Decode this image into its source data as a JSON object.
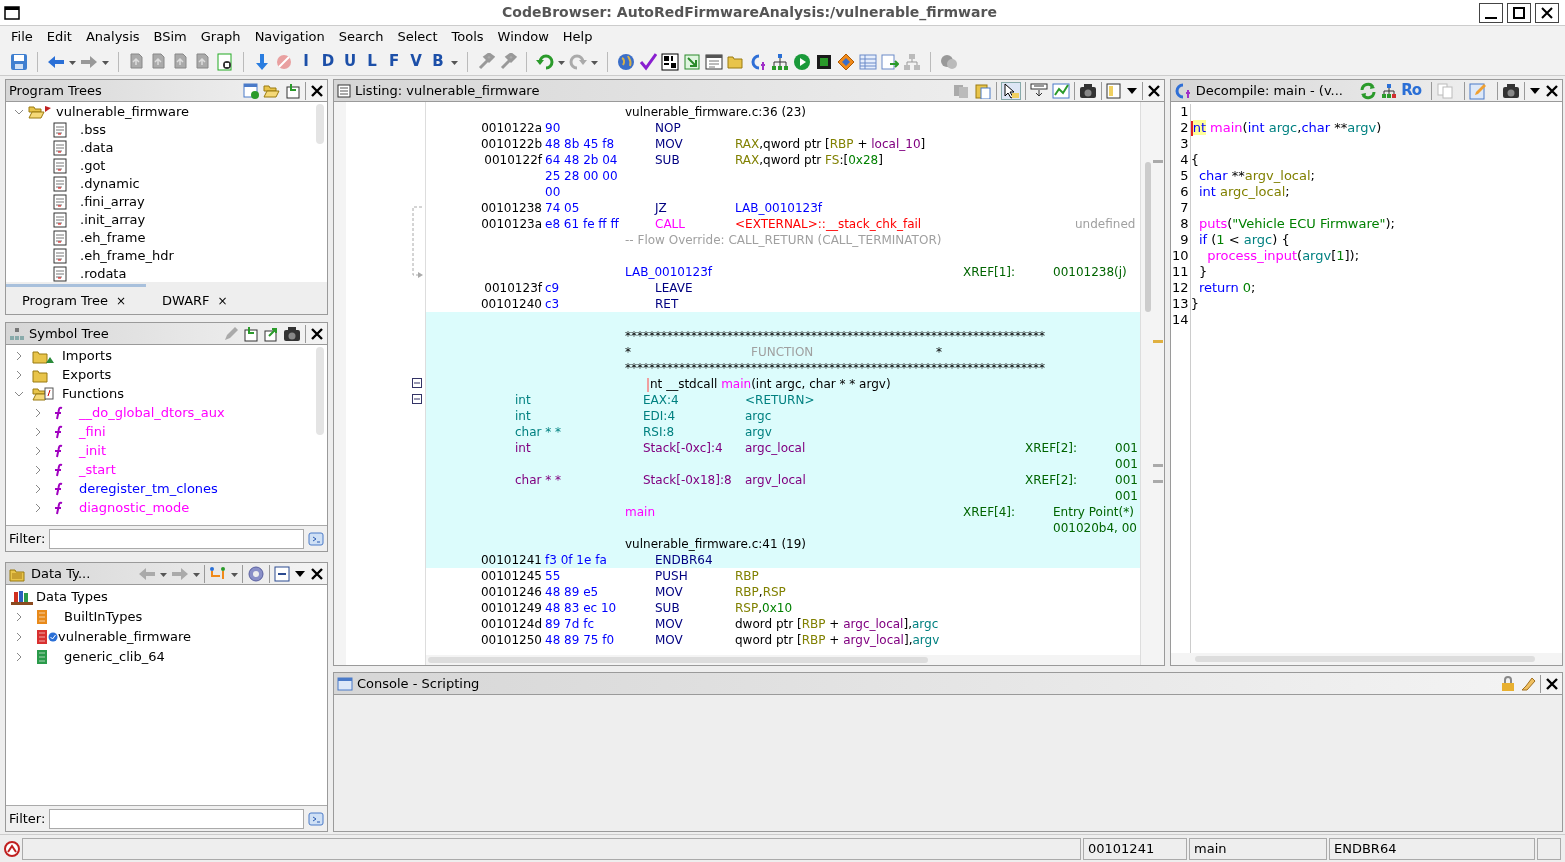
{
  "window": {
    "title": "CodeBrowser: AutoRedFirmwareAnalysis:/vulnerable_firmware"
  },
  "menu": [
    "File",
    "Edit",
    "Analysis",
    "BSim",
    "Graph",
    "Navigation",
    "Search",
    "Select",
    "Tools",
    "Window",
    "Help"
  ],
  "toolbar": {
    "letter_buttons": [
      "I",
      "D",
      "U",
      "L",
      "F",
      "V",
      "B"
    ]
  },
  "program_trees": {
    "title": "Program Trees",
    "tree": [
      {
        "label": "vulnerable_firmware",
        "expanded": true,
        "children": [
          {
            "label": ".bss"
          },
          {
            "label": ".data"
          },
          {
            "label": ".got"
          },
          {
            "label": ".dynamic"
          },
          {
            "label": ".fini_array"
          },
          {
            "label": ".init_array"
          },
          {
            "label": ".eh_frame"
          },
          {
            "label": ".eh_frame_hdr"
          },
          {
            "label": ".rodata"
          }
        ]
      }
    ],
    "tabs": [
      {
        "label": "Program Tree",
        "close": "×",
        "selected": true
      },
      {
        "label": "DWARF",
        "close": "×",
        "selected": false
      }
    ]
  },
  "symbol_tree": {
    "title": "Symbol Tree",
    "items": [
      {
        "label": "Imports",
        "kind": "imports",
        "expanded": false
      },
      {
        "label": "Exports",
        "kind": "exports",
        "expanded": false
      },
      {
        "label": "Functions",
        "kind": "functions",
        "expanded": true,
        "children": [
          {
            "label": "__do_global_dtors_aux",
            "color": "#ff00ff"
          },
          {
            "label": "_fini",
            "color": "#ff00ff"
          },
          {
            "label": "_init",
            "color": "#ff00ff"
          },
          {
            "label": "_start",
            "color": "#ff00ff"
          },
          {
            "label": "deregister_tm_clones",
            "color": "#0000ff"
          },
          {
            "label": "diagnostic_mode",
            "color": "#ff00ff"
          }
        ]
      }
    ],
    "filter_label": "Filter:"
  },
  "data_types": {
    "title": "Data Ty...",
    "root": "Data Types",
    "items": [
      {
        "label": "BuiltInTypes",
        "kind": "builtin"
      },
      {
        "label": "vulnerable_firmware",
        "kind": "program"
      },
      {
        "label": "generic_clib_64",
        "kind": "archive"
      }
    ],
    "filter_label": "Filter:"
  },
  "listing": {
    "title": "Listing:  vulnerable_firmware",
    "rows": [
      {
        "highlighted": false,
        "parts": [
          {
            "kind": "source",
            "text": "vulnerable_firmware.c:36 (23)"
          }
        ]
      },
      {
        "highlighted": false,
        "parts": [
          {
            "kind": "address",
            "text": "0010122a"
          },
          {
            "kind": "bytes",
            "text": "90"
          },
          {
            "kind": "mnemonic",
            "text": "NOP"
          }
        ]
      },
      {
        "highlighted": false,
        "parts": [
          {
            "kind": "address",
            "text": "0010122b"
          },
          {
            "kind": "bytes",
            "text": "48 8b 45 f8"
          },
          {
            "kind": "mnemonic",
            "text": "MOV"
          },
          {
            "kind": "operands",
            "tokens": [
              {
                "text": "RAX",
                "kind": "register"
              },
              {
                "text": ",qword ptr [",
                "kind": "plain"
              },
              {
                "text": "RBP",
                "kind": "register"
              },
              {
                "text": " + ",
                "kind": "plain"
              },
              {
                "text": "local_10",
                "kind": "local"
              },
              {
                "text": "]",
                "kind": "plain"
              }
            ]
          }
        ]
      },
      {
        "highlighted": false,
        "parts": [
          {
            "kind": "address",
            "text": "0010122f"
          },
          {
            "kind": "bytes",
            "text": "64 48 2b 04"
          },
          {
            "kind": "mnemonic",
            "text": "SUB"
          },
          {
            "kind": "operands",
            "tokens": [
              {
                "text": "RAX",
                "kind": "register"
              },
              {
                "text": ",qword ptr ",
                "kind": "plain"
              },
              {
                "text": "FS",
                "kind": "register"
              },
              {
                "text": ":[",
                "kind": "plain"
              },
              {
                "text": "0x28",
                "kind": "constant"
              },
              {
                "text": "]",
                "kind": "plain"
              }
            ]
          }
        ]
      },
      {
        "highlighted": false,
        "parts": [
          {
            "kind": "bytes",
            "text": "25 28 00 00"
          }
        ]
      },
      {
        "highlighted": false,
        "parts": [
          {
            "kind": "bytes",
            "text": "00"
          }
        ]
      },
      {
        "highlighted": false,
        "parts": [
          {
            "kind": "address",
            "text": "00101238"
          },
          {
            "kind": "bytes",
            "text": "74 05"
          },
          {
            "kind": "mnemonic",
            "text": "JZ"
          },
          {
            "kind": "operands",
            "tokens": [
              {
                "text": "LAB_0010123f",
                "kind": "label"
              }
            ]
          }
        ]
      },
      {
        "highlighted": false,
        "parts": [
          {
            "kind": "address",
            "text": "0010123a"
          },
          {
            "kind": "bytes",
            "text": "e8 61 fe ff ff"
          },
          {
            "kind": "mnemonic",
            "tokens": [
              {
                "text": "CALL",
                "kind": "call"
              }
            ]
          },
          {
            "kind": "operands",
            "tokens": [
              {
                "text": "<EXTERNAL>::__stack_chk_fail",
                "kind": "external"
              }
            ]
          },
          {
            "kind": "note",
            "text": "undefined"
          }
        ]
      },
      {
        "highlighted": false,
        "parts": [
          {
            "kind": "source",
            "tokens": [
              {
                "text": "-- Flow Override: CALL_RETURN (CALL_TERMINATOR)",
                "kind": "comment"
              }
            ]
          }
        ]
      },
      {
        "kind": "label_block",
        "highlighted": false,
        "parts": [
          {
            "kind": "source",
            "tokens": [
              {
                "text": "LAB_0010123f",
                "kind": "label"
              }
            ]
          },
          {
            "kind": "xref_label",
            "text": "XREF[1]:"
          },
          {
            "kind": "xref_value",
            "text": "00101238(j)"
          }
        ]
      },
      {
        "highlighted": false,
        "parts": [
          {
            "kind": "address",
            "text": "0010123f"
          },
          {
            "kind": "bytes",
            "text": "c9"
          },
          {
            "kind": "mnemonic",
            "text": "LEAVE"
          }
        ]
      },
      {
        "highlighted": false,
        "parts": [
          {
            "kind": "address",
            "text": "00101240"
          },
          {
            "kind": "bytes",
            "text": "c3"
          },
          {
            "kind": "mnemonic",
            "text": "RET"
          }
        ]
      },
      {
        "highlighted": true
      },
      {
        "highlighted": true,
        "parts": [
          {
            "kind": "source",
            "text": "**********************************************************************"
          }
        ]
      },
      {
        "highlighted": true,
        "parts": [
          {
            "kind": "source",
            "text": "*"
          },
          {
            "kind": "banner",
            "text": "FUNCTION"
          },
          {
            "kind": "banner_end",
            "text": "*"
          }
        ]
      },
      {
        "highlighted": true,
        "parts": [
          {
            "kind": "source",
            "text": "**********************************************************************"
          }
        ]
      },
      {
        "highlighted": true,
        "cursor": true,
        "parts": [
          {
            "kind": "signature",
            "tokens": [
              {
                "text": "nt __stdcall ",
                "kind": "plain"
              },
              {
                "text": "main",
                "kind": "function"
              },
              {
                "text": "(int argc, char * * argv)",
                "kind": "plain"
              }
            ]
          }
        ]
      },
      {
        "highlighted": true,
        "parts": [
          {
            "kind": "param_type",
            "text": "int"
          },
          {
            "kind": "param_storage",
            "text": "EAX:4"
          },
          {
            "kind": "param_name",
            "text": "<RETURN>"
          }
        ]
      },
      {
        "highlighted": true,
        "parts": [
          {
            "kind": "param_type",
            "text": "int"
          },
          {
            "kind": "param_storage",
            "text": "EDI:4"
          },
          {
            "kind": "param_name",
            "text": "argc"
          }
        ]
      },
      {
        "highlighted": true,
        "parts": [
          {
            "kind": "param_type",
            "text": "char * *"
          },
          {
            "kind": "param_storage",
            "text": "RSI:8"
          },
          {
            "kind": "param_name",
            "text": "argv"
          }
        ]
      },
      {
        "highlighted": true,
        "parts": [
          {
            "kind": "param_type",
            "tokens": [
              {
                "text": "int",
                "kind": "local"
              }
            ]
          },
          {
            "kind": "param_storage",
            "tokens": [
              {
                "text": "Stack[-0xc]:4",
                "kind": "local"
              }
            ]
          },
          {
            "kind": "param_name",
            "tokens": [
              {
                "text": "argc_local",
                "kind": "local"
              }
            ]
          },
          {
            "kind": "param_xref_label",
            "text": "XREF[2]:"
          },
          {
            "kind": "param_xref_value",
            "text": "001"
          }
        ]
      },
      {
        "highlighted": true,
        "parts": [
          {
            "kind": "param_xref_value",
            "text": "001"
          }
        ]
      },
      {
        "highlighted": true,
        "parts": [
          {
            "kind": "param_type",
            "tokens": [
              {
                "text": "char * *",
                "kind": "local"
              }
            ]
          },
          {
            "kind": "param_storage",
            "tokens": [
              {
                "text": "Stack[-0x18]:8",
                "kind": "local"
              }
            ]
          },
          {
            "kind": "param_name",
            "tokens": [
              {
                "text": "argv_local",
                "kind": "local"
              }
            ]
          },
          {
            "kind": "param_xref_label",
            "text": "XREF[2]:"
          },
          {
            "kind": "param_xref_value",
            "text": "001"
          }
        ]
      },
      {
        "highlighted": true,
        "parts": [
          {
            "kind": "param_xref_value",
            "text": "001"
          }
        ]
      },
      {
        "highlighted": true,
        "parts": [
          {
            "kind": "source",
            "tokens": [
              {
                "text": "main",
                "kind": "function"
              }
            ]
          },
          {
            "kind": "xref_label",
            "text": "XREF[4]:"
          },
          {
            "kind": "xref_value",
            "text": "Entry Point(*)"
          }
        ]
      },
      {
        "highlighted": true,
        "parts": [
          {
            "kind": "xref_value",
            "text": "001020b4, 00"
          }
        ]
      },
      {
        "highlighted": true,
        "parts": [
          {
            "kind": "source",
            "text": "vulnerable_firmware.c:41 (19)"
          }
        ]
      },
      {
        "highlighted": true,
        "parts": [
          {
            "kind": "address",
            "text": "00101241"
          },
          {
            "kind": "bytes",
            "text": "f3 0f 1e fa"
          },
          {
            "kind": "mnemonic",
            "text": "ENDBR64"
          }
        ]
      },
      {
        "highlighted": false,
        "parts": [
          {
            "kind": "address",
            "text": "00101245"
          },
          {
            "kind": "bytes",
            "text": "55"
          },
          {
            "kind": "mnemonic",
            "text": "PUSH"
          },
          {
            "kind": "operands",
            "tokens": [
              {
                "text": "RBP",
                "kind": "register"
              }
            ]
          }
        ]
      },
      {
        "highlighted": false,
        "parts": [
          {
            "kind": "address",
            "text": "00101246"
          },
          {
            "kind": "bytes",
            "text": "48 89 e5"
          },
          {
            "kind": "mnemonic",
            "text": "MOV"
          },
          {
            "kind": "operands",
            "tokens": [
              {
                "text": "RBP",
                "kind": "register"
              },
              {
                "text": ",",
                "kind": "plain"
              },
              {
                "text": "RSP",
                "kind": "register"
              }
            ]
          }
        ]
      },
      {
        "highlighted": false,
        "parts": [
          {
            "kind": "address",
            "text": "00101249"
          },
          {
            "kind": "bytes",
            "text": "48 83 ec 10"
          },
          {
            "kind": "mnemonic",
            "text": "SUB"
          },
          {
            "kind": "operands",
            "tokens": [
              {
                "text": "RSP",
                "kind": "register"
              },
              {
                "text": ",",
                "kind": "plain"
              },
              {
                "text": "0x10",
                "kind": "constant"
              }
            ]
          }
        ]
      },
      {
        "highlighted": false,
        "parts": [
          {
            "kind": "address",
            "text": "0010124d"
          },
          {
            "kind": "bytes",
            "text": "89 7d fc"
          },
          {
            "kind": "mnemonic",
            "text": "MOV"
          },
          {
            "kind": "operands",
            "tokens": [
              {
                "text": "dword ptr [",
                "kind": "plain"
              },
              {
                "text": "RBP",
                "kind": "register"
              },
              {
                "text": " + ",
                "kind": "plain"
              },
              {
                "text": "argc_local",
                "kind": "local"
              },
              {
                "text": "],",
                "kind": "plain"
              },
              {
                "text": "argc",
                "kind": "param"
              }
            ]
          }
        ]
      },
      {
        "highlighted": false,
        "parts": [
          {
            "kind": "address",
            "text": "00101250"
          },
          {
            "kind": "bytes",
            "text": "48 89 75 f0"
          },
          {
            "kind": "mnemonic",
            "text": "MOV"
          },
          {
            "kind": "operands",
            "tokens": [
              {
                "text": "qword ptr [",
                "kind": "plain"
              },
              {
                "text": "RBP",
                "kind": "register"
              },
              {
                "text": " + ",
                "kind": "plain"
              },
              {
                "text": "argv_local",
                "kind": "local"
              },
              {
                "text": "],",
                "kind": "plain"
              },
              {
                "text": "argv",
                "kind": "param"
              }
            ]
          }
        ]
      }
    ]
  },
  "decompiler": {
    "title": "Decompile: main -  (v...",
    "read_only_label": "Ro",
    "lines": [
      {
        "number": "1"
      },
      {
        "number": "2",
        "cursor": true,
        "tokens": [
          {
            "text": "nt",
            "kind": "selected_keyword"
          },
          {
            "text": " main",
            "kind": "function"
          },
          {
            "text": "(",
            "kind": "plain"
          },
          {
            "text": "int",
            "kind": "keyword"
          },
          {
            "text": " argc",
            "kind": "param"
          },
          {
            "text": ",",
            "kind": "plain"
          },
          {
            "text": "char",
            "kind": "keyword"
          },
          {
            "text": " **",
            "kind": "plain"
          },
          {
            "text": "argv",
            "kind": "param"
          },
          {
            "text": ")",
            "kind": "plain"
          }
        ]
      },
      {
        "number": "3"
      },
      {
        "number": "4",
        "tokens": [
          {
            "text": "{",
            "kind": "plain"
          }
        ]
      },
      {
        "number": "5",
        "tokens": [
          {
            "text": "  char",
            "kind": "keyword"
          },
          {
            "text": " **",
            "kind": "plain"
          },
          {
            "text": "argv_local",
            "kind": "variable"
          },
          {
            "text": ";",
            "kind": "plain"
          }
        ]
      },
      {
        "number": "6",
        "tokens": [
          {
            "text": "  int",
            "kind": "keyword"
          },
          {
            "text": " argc_local",
            "kind": "variable"
          },
          {
            "text": ";",
            "kind": "plain"
          }
        ]
      },
      {
        "number": "7"
      },
      {
        "number": "8",
        "tokens": [
          {
            "text": "  puts",
            "kind": "function"
          },
          {
            "text": "(",
            "kind": "plain"
          },
          {
            "text": "\"Vehicle ECU Firmware\"",
            "kind": "constant"
          },
          {
            "text": ");",
            "kind": "plain"
          }
        ]
      },
      {
        "number": "9",
        "tokens": [
          {
            "text": "  if",
            "kind": "keyword"
          },
          {
            "text": " (",
            "kind": "plain"
          },
          {
            "text": "1",
            "kind": "constant"
          },
          {
            "text": " < ",
            "kind": "plain"
          },
          {
            "text": "argc",
            "kind": "param"
          },
          {
            "text": ") {",
            "kind": "plain"
          }
        ]
      },
      {
        "number": "10",
        "tokens": [
          {
            "text": "    process_input",
            "kind": "function"
          },
          {
            "text": "(",
            "kind": "plain"
          },
          {
            "text": "argv",
            "kind": "param"
          },
          {
            "text": "[",
            "kind": "plain"
          },
          {
            "text": "1",
            "kind": "constant"
          },
          {
            "text": "]);",
            "kind": "plain"
          }
        ]
      },
      {
        "number": "11",
        "tokens": [
          {
            "text": "  }",
            "kind": "plain"
          }
        ]
      },
      {
        "number": "12",
        "tokens": [
          {
            "text": "  return",
            "kind": "keyword"
          },
          {
            "text": " 0",
            "kind": "constant"
          },
          {
            "text": ";",
            "kind": "plain"
          }
        ]
      },
      {
        "number": "13",
        "tokens": [
          {
            "text": "}",
            "kind": "plain"
          }
        ]
      },
      {
        "number": "14"
      }
    ]
  },
  "console": {
    "title": "Console - Scripting"
  },
  "status_bar": {
    "fields": [
      "00101241",
      "main",
      "ENDBR64"
    ]
  }
}
